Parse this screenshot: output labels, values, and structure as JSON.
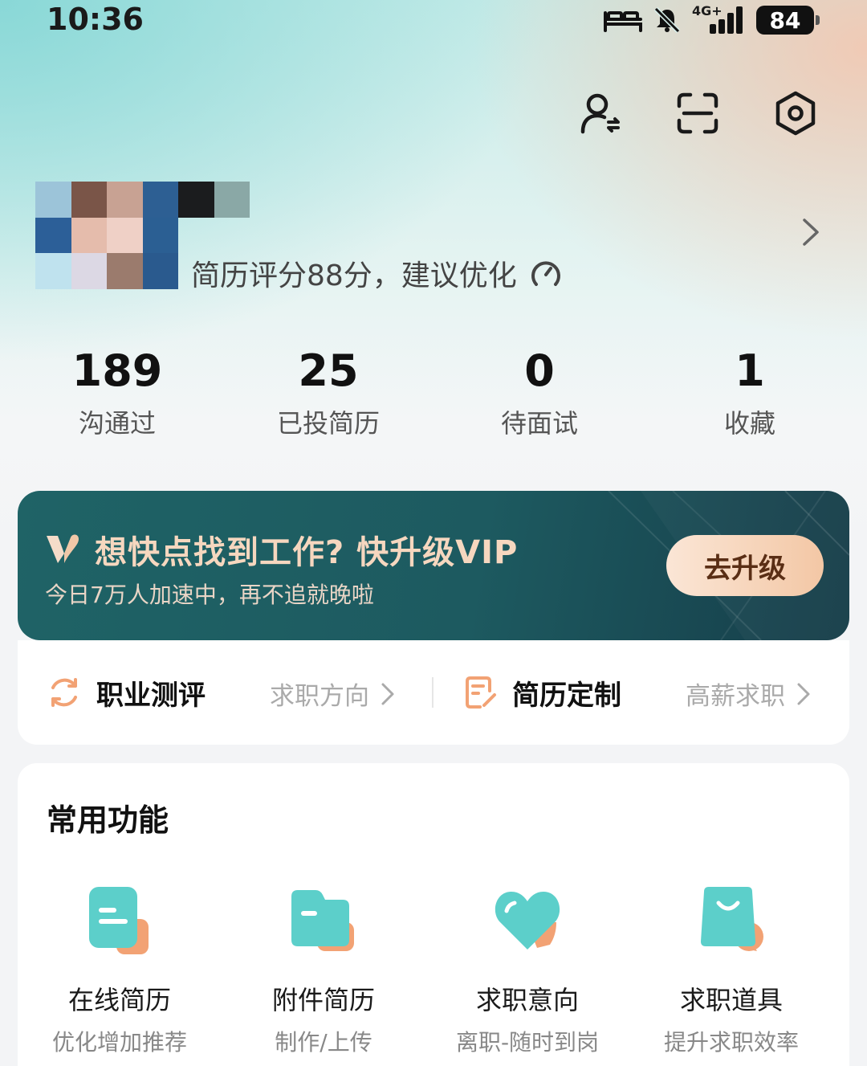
{
  "status_bar": {
    "time": "10:36",
    "network": "4G+",
    "battery": "84"
  },
  "top_icons": [
    "switch-identity-icon",
    "scan-icon",
    "settings-icon"
  ],
  "profile": {
    "score_text": "简历评分88分，建议优化"
  },
  "stats": [
    {
      "value": "189",
      "label": "沟通过"
    },
    {
      "value": "25",
      "label": "已投简历"
    },
    {
      "value": "0",
      "label": "待面试"
    },
    {
      "value": "1",
      "label": "收藏"
    }
  ],
  "vip": {
    "title": "想快点找到工作? 快升级VIP",
    "subtitle": "今日7万人加速中，再不追就晚啦",
    "button": "去升级"
  },
  "shortcuts": [
    {
      "title": "职业测评",
      "sub": "求职方向"
    },
    {
      "title": "简历定制",
      "sub": "高薪求职"
    }
  ],
  "functions": {
    "title": "常用功能",
    "items": [
      {
        "label": "在线简历",
        "sub": "优化增加推荐"
      },
      {
        "label": "附件简历",
        "sub": "制作/上传"
      },
      {
        "label": "求职意向",
        "sub": "离职-随时到岗"
      },
      {
        "label": "求职道具",
        "sub": "提升求职效率"
      }
    ]
  },
  "colors": {
    "accent_teal": "#5ccfca",
    "accent_orange": "#f2a274",
    "vip_bg": "#1f6366",
    "vip_text": "#f6d7bf"
  }
}
